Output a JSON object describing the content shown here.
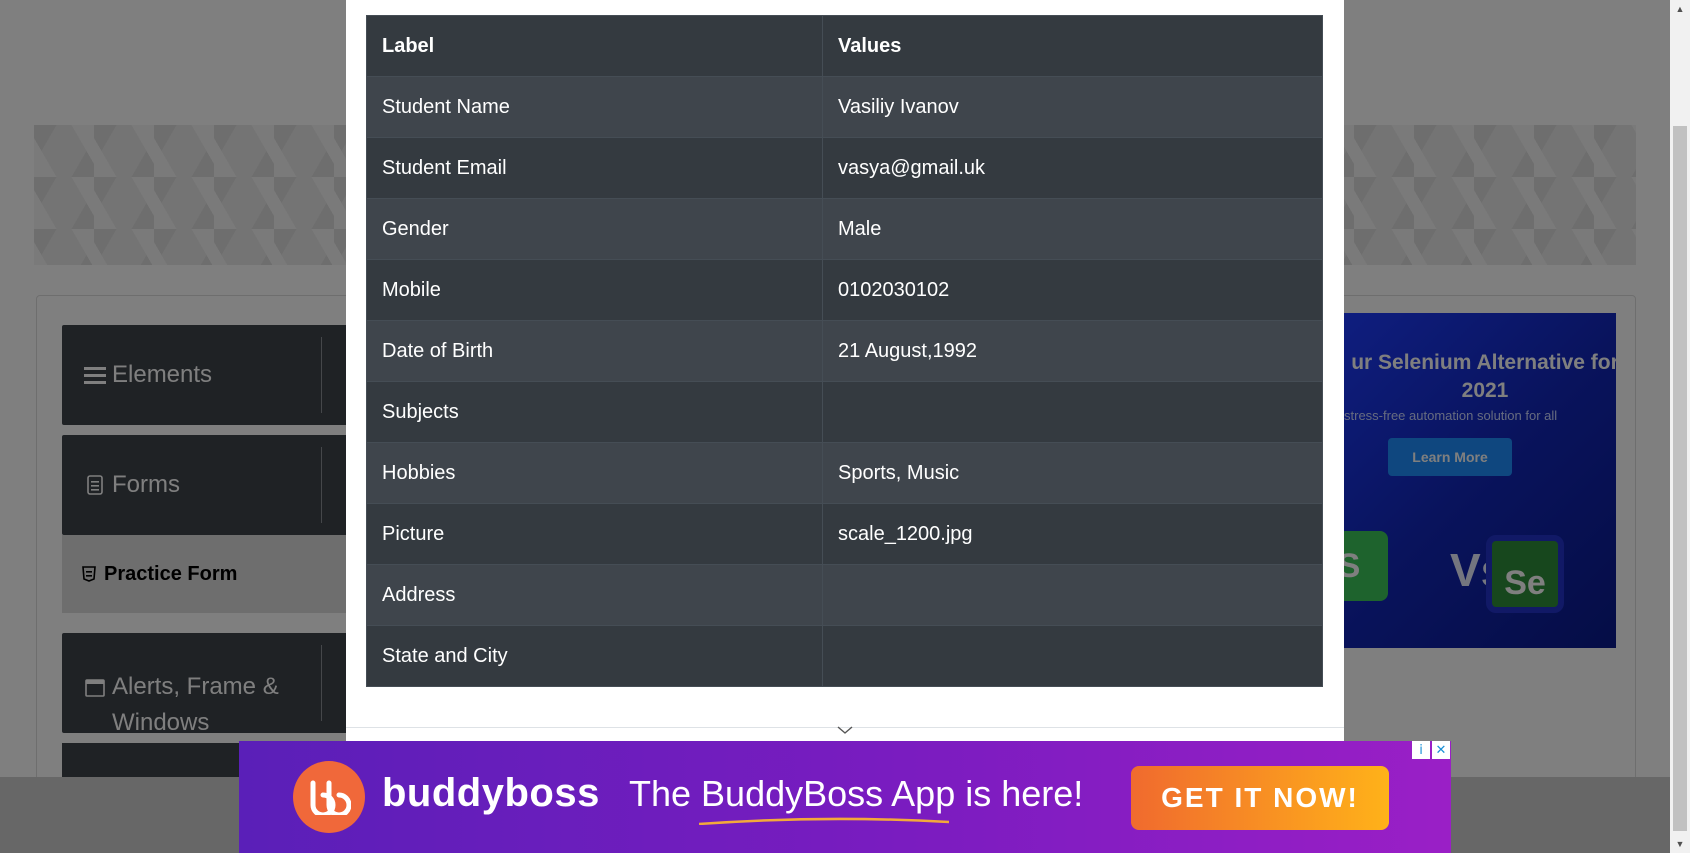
{
  "sidebar": {
    "groups": [
      {
        "label": "Elements",
        "icon": "hamburger-icon"
      },
      {
        "label": "Forms",
        "icon": "document-icon"
      },
      {
        "label": "Alerts, Frame & Windows",
        "icon": "window-icon"
      }
    ],
    "active_item": "Practice Form"
  },
  "side_ad": {
    "headline": "ur Selenium Alternative for 2021",
    "subtext": "stress-free automation solution for all",
    "button": "Learn More",
    "vs": "Vs",
    "cy_logo": "S",
    "se_logo": "Se"
  },
  "modal": {
    "table": {
      "headers": [
        "Label",
        "Values"
      ],
      "rows": [
        {
          "label": "Student Name",
          "value": "Vasiliy Ivanov"
        },
        {
          "label": "Student Email",
          "value": "vasya@gmail.uk"
        },
        {
          "label": "Gender",
          "value": "Male"
        },
        {
          "label": "Mobile",
          "value": "0102030102"
        },
        {
          "label": "Date of Birth",
          "value": "21 August,1992"
        },
        {
          "label": "Subjects",
          "value": ""
        },
        {
          "label": "Hobbies",
          "value": "Sports, Music"
        },
        {
          "label": "Picture",
          "value": "scale_1200.jpg"
        },
        {
          "label": "Address",
          "value": ""
        },
        {
          "label": "State and City",
          "value": ""
        }
      ]
    }
  },
  "bottom_ad": {
    "brand": "buddyboss",
    "headline": "The BuddyBoss App is here!",
    "cta": "GET IT NOW!",
    "info_icon": "i",
    "close_icon": "✕"
  },
  "colors": {
    "table_dark": "#343a40",
    "table_stripe": "#3f454c",
    "overlay": "rgba(0,0,0,0.5)",
    "ad_purple": "#7a1cc0",
    "cta_orange": "#f06a2e"
  }
}
